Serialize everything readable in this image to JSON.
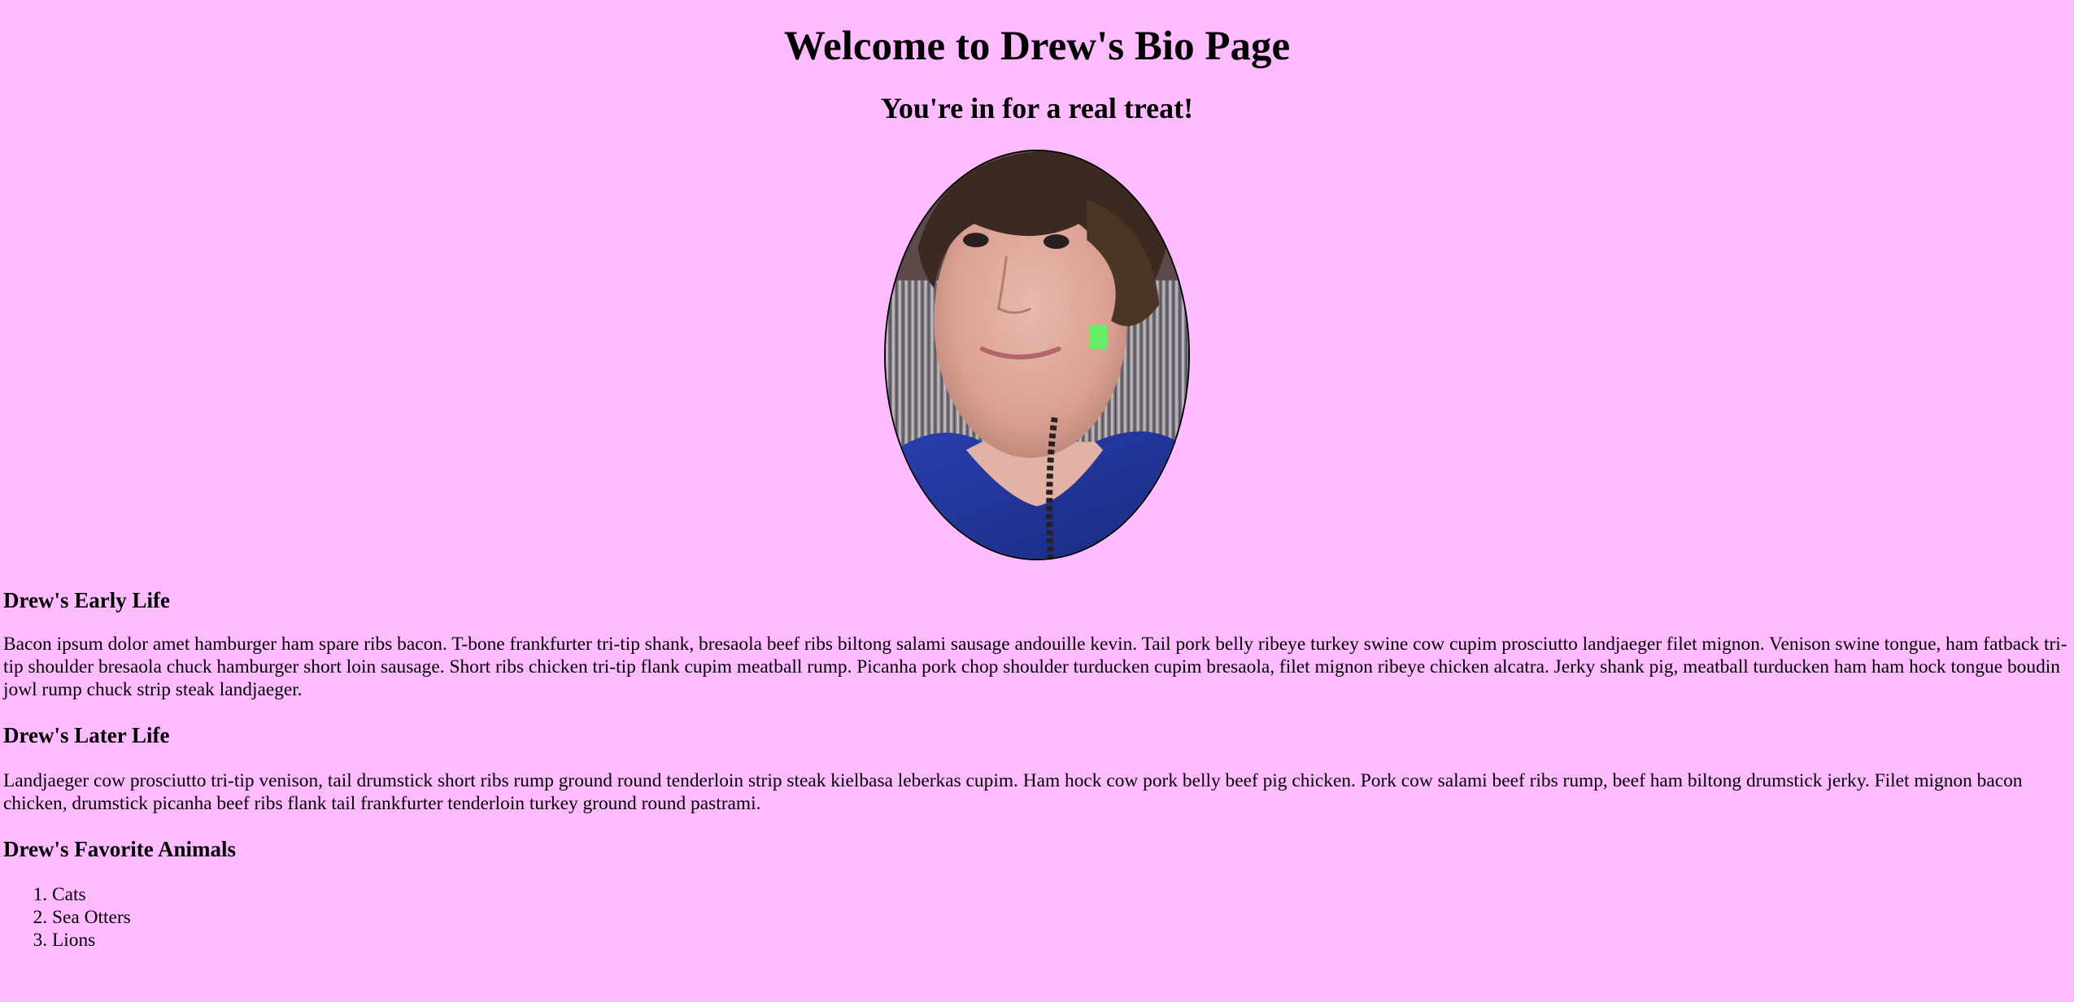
{
  "page": {
    "title": "Welcome to Drew's Bio Page",
    "subtitle": "You're in for a real treat!",
    "background_color": "#ffbbff"
  },
  "photo": {
    "alt": "portrait-photo"
  },
  "early_life": {
    "heading": "Drew's Early Life",
    "text": "Bacon ipsum dolor amet hamburger ham spare ribs bacon. T-bone frankfurter tri-tip shank, bresaola beef ribs biltong salami sausage andouille kevin. Tail pork belly ribeye turkey swine cow cupim prosciutto landjaeger filet mignon. Venison swine tongue, ham fatback tri-tip shoulder bresaola chuck hamburger short loin sausage. Short ribs chicken tri-tip flank cupim meatball rump. Picanha pork chop shoulder turducken cupim bresaola, filet mignon ribeye chicken alcatra. Jerky shank pig, meatball turducken ham ham hock tongue boudin jowl rump chuck strip steak landjaeger."
  },
  "later_life": {
    "heading": "Drew's Later Life",
    "text": "Landjaeger cow prosciutto tri-tip venison, tail drumstick short ribs rump ground round tenderloin strip steak kielbasa leberkas cupim. Ham hock cow pork belly beef pig chicken. Pork cow salami beef ribs rump, beef ham biltong drumstick jerky. Filet mignon bacon chicken, drumstick picanha beef ribs flank tail frankfurter tenderloin turkey ground round pastrami."
  },
  "favorite_animals": {
    "heading": "Drew's Favorite Animals",
    "items": [
      "Cats",
      "Sea Otters",
      "Lions"
    ]
  }
}
